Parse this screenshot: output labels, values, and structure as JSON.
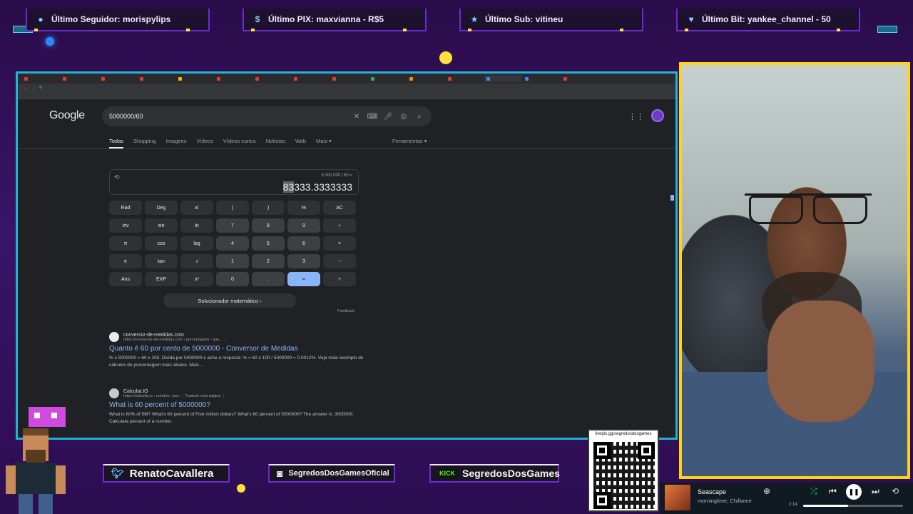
{
  "overlay": {
    "alerts": [
      {
        "label": "Último Seguidor: morispylips",
        "icon": "user-icon"
      },
      {
        "label": "Último PIX: maxvianna - R$5",
        "icon": "dollar-icon"
      },
      {
        "label": "Último Sub: vitineu",
        "icon": "star-icon"
      },
      {
        "label": "Último Bit: yankee_channel - 50",
        "icon": "diamond-icon"
      }
    ],
    "social": [
      {
        "handle": "RenatoCavallera",
        "icon": "twitter-icon"
      },
      {
        "handle": "SegredosDosGamesOficial",
        "icon": "instagram-icon"
      },
      {
        "handle": "SegredosDosGames",
        "icon": "kick-icon",
        "badge": "KICK"
      }
    ],
    "qr_caption": "livepix.gg/segredosdosgames",
    "accent": "#6b2bd6",
    "frame_color": "#1fb5d8",
    "webcam_border": "#ffd21e"
  },
  "google": {
    "logo": "Google",
    "query": "5000000/60",
    "tabs": [
      "Todas",
      "Shopping",
      "Imagens",
      "Vídeos",
      "Vídeos curtos",
      "Notícias",
      "Web",
      "Mais ▾"
    ],
    "tools": "Ferramentas ▾",
    "calculator": {
      "expression": "5 000 000 / 60 =",
      "result_selected": "83",
      "result_rest": "333.3333333",
      "keys": [
        [
          "Rad",
          "Deg",
          "x!",
          "(",
          ")",
          "%",
          "AC"
        ],
        [
          "Inv",
          "sin",
          "ln",
          "7",
          "8",
          "9",
          "÷"
        ],
        [
          "π",
          "cos",
          "log",
          "4",
          "5",
          "6",
          "×"
        ],
        [
          "e",
          "tan",
          "√",
          "1",
          "2",
          "3",
          "−"
        ],
        [
          "Ans",
          "EXP",
          "xʸ",
          "0",
          ".",
          "=",
          "+"
        ]
      ],
      "solver": "Solucionador matemático  ›",
      "feedback": "Feedback"
    },
    "results": [
      {
        "site": "conversor-de-medidas.com",
        "url": "https://conversor-de-medidas.com › porcentagem › que...  ⋮",
        "title": "Quanto é 60 por cento de 5000000 - Conversor de Medidas",
        "snippet": "% x 5000000 = 60 x 100. Divida por 5000000 e ache a resposta: % = 60 x 100 / 5000000 = 0.0012%. Veja mais exemplo de cálculos de porcentagem mais abaixo. Mais ..."
      },
      {
        "site": "Calculat.IO",
        "url": "https://calculat.io › number › per...  · Traduzir esta página  ⋮",
        "title": "What is 60 percent of 5000000?",
        "snippet": "What is 60% of 5M? What's 60 percent of Five million dollars? What's 60 percent of 5000000? The answer is: 3000000. Calculate percent of a number."
      }
    ]
  },
  "player": {
    "song": "Seascape",
    "artist": "morningtime, Chillwme",
    "time": "2:14",
    "progress": 0.45
  }
}
